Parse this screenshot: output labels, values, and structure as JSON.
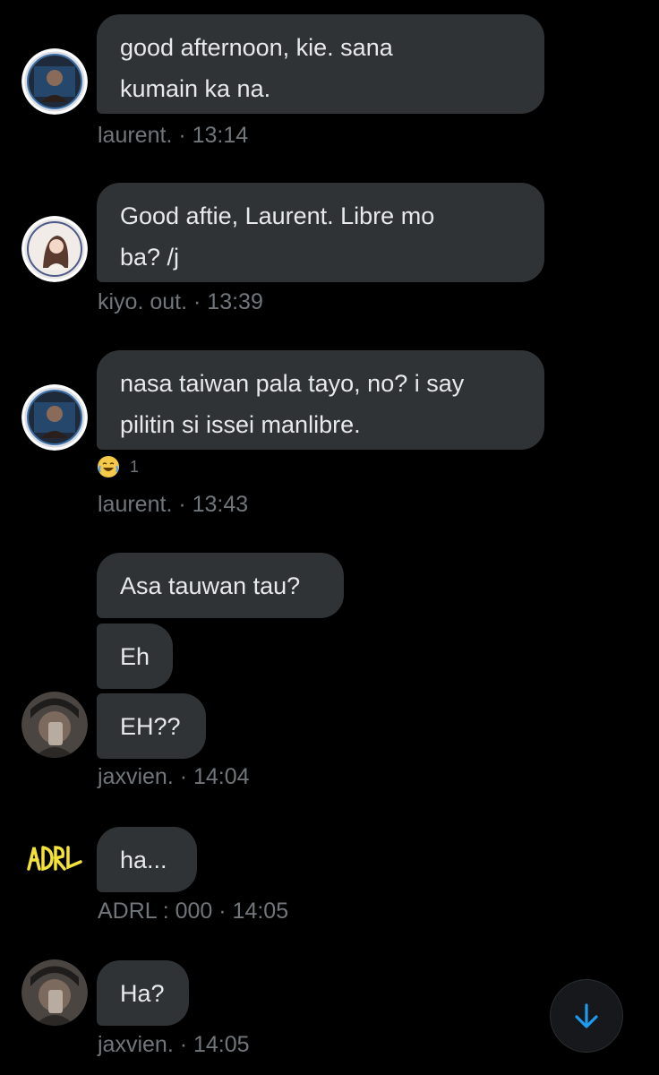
{
  "messages": [
    {
      "text_lines": [
        "good afternoon, kie. sana",
        "kumain ka na."
      ],
      "author": "laurent.",
      "time": "13:14"
    },
    {
      "text_lines": [
        "Good aftie, Laurent. Libre mo",
        "ba? /j"
      ],
      "author": "kiyo. out.",
      "time": "13:39"
    },
    {
      "text_lines": [
        "nasa taiwan pala tayo, no? i say",
        "pilitin si issei manlibre."
      ],
      "reaction": {
        "emoji": "face-with-tears-of-joy-icon",
        "count": "1"
      },
      "author": "laurent.",
      "time": "13:43"
    },
    {
      "bubbles": [
        "Asa tauwan tau?",
        "Eh",
        "EH??"
      ],
      "author": "jaxvien.",
      "time": "14:04"
    },
    {
      "text_lines": [
        "ha..."
      ],
      "avatar_text": "ADRL",
      "author": "ADRL : 000",
      "time": "14:05"
    },
    {
      "text_lines": [
        "Ha?"
      ],
      "author": "jaxvien.",
      "time": "14:05"
    }
  ],
  "separator": "·",
  "colors": {
    "background": "#000000",
    "bubble": "#2f3336",
    "text": "#e7e9ea",
    "meta": "#71767b",
    "accent": "#1d9bf0"
  },
  "scroll_button": {
    "icon": "arrow-down-icon"
  }
}
